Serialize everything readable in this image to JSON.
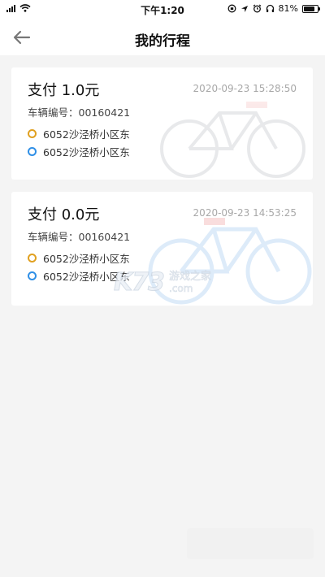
{
  "status_bar": {
    "time": "下午1:20",
    "battery_percent": "81%",
    "battery_level": 0.81,
    "icons": [
      "signal-icon",
      "wifi-icon",
      "screen-lock-icon",
      "location-icon",
      "alarm-icon",
      "headphones-icon",
      "battery-icon"
    ]
  },
  "nav": {
    "title": "我的行程",
    "back_icon": "arrow-left-icon"
  },
  "trips": [
    {
      "title": "支付 1.0元",
      "time": "2020-09-23 15:28:50",
      "vehicle": "车辆编号：00160421",
      "start": "6052沙泾桥小区东",
      "end": "6052沙泾桥小区东"
    },
    {
      "title": "支付 0.0元",
      "time": "2020-09-23 14:53:25",
      "vehicle": "车辆编号：00160421",
      "start": "6052沙泾桥小区东",
      "end": "6052沙泾桥小区东"
    }
  ],
  "colors": {
    "start_dot": "#e0a020",
    "end_dot": "#2f8fe6",
    "card_bg": "#ffffff",
    "page_bg": "#f4f4f4"
  },
  "watermark": {
    "logo": "K73",
    "line1": "游戏之家",
    "line2": ".com"
  }
}
